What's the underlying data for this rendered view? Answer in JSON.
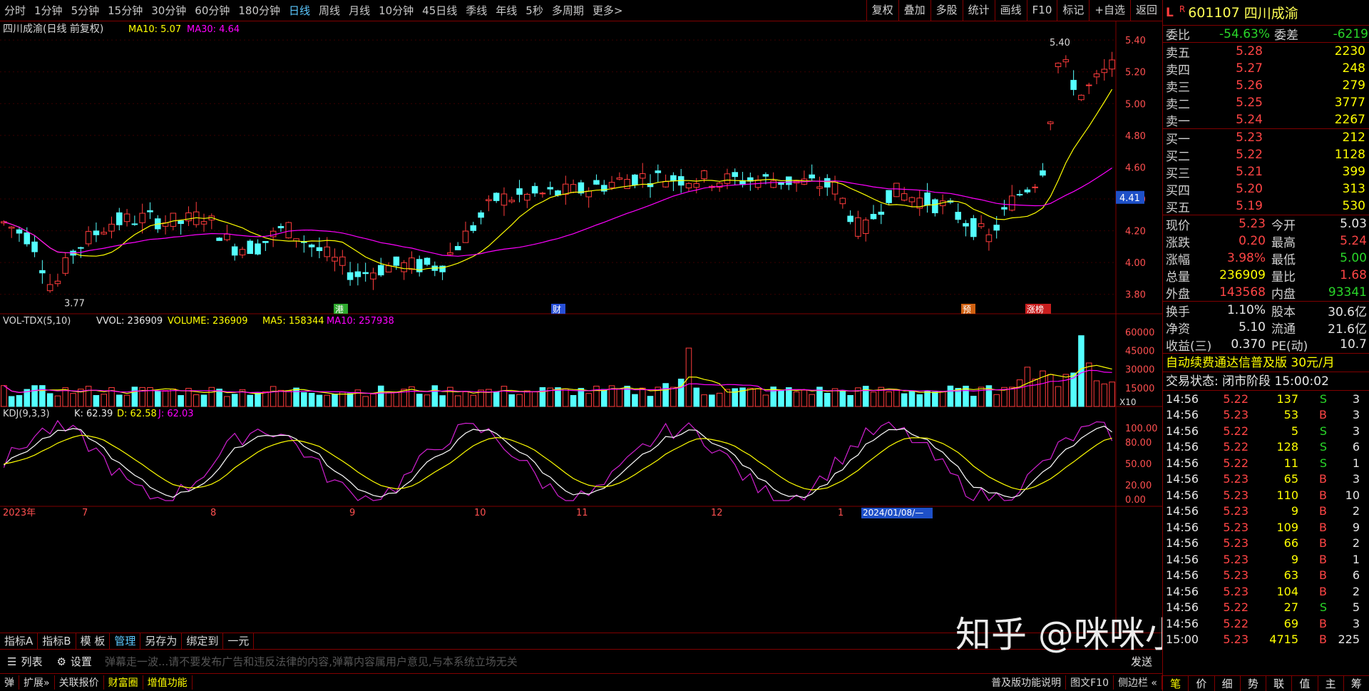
{
  "toolbar": {
    "periods": [
      "分时",
      "1分钟",
      "5分钟",
      "15分钟",
      "30分钟",
      "60分钟",
      "180分钟",
      "日线",
      "周线",
      "月线",
      "10分钟",
      "45日线",
      "季线",
      "年线",
      "5秒",
      "多周期",
      "更多>"
    ],
    "active_period": "日线",
    "tools": [
      "复权",
      "叠加",
      "多股",
      "统计",
      "画线",
      "F10",
      "标记",
      "+自选",
      "返回"
    ]
  },
  "main_header": {
    "title": "四川成渝(日线 前复权)",
    "ma10": "MA10: 5.07",
    "ma30": "MA30: 4.64"
  },
  "price_axis": [
    "5.40",
    "5.20",
    "5.00",
    "4.80",
    "4.60",
    "4.40",
    "4.20",
    "4.00",
    "3.80"
  ],
  "current_price_tag": "4.41",
  "annotations": {
    "high": "5.40",
    "low": "3.77"
  },
  "event_markers": [
    "港",
    "财",
    "预",
    "涨榜"
  ],
  "vol_header": {
    "name": "VOL-TDX(5,10)",
    "vvol": "VVOL: 236909",
    "volume": "VOLUME: 236909",
    "ma5": "MA5: 158344",
    "ma10": "MA10: 257938"
  },
  "vol_axis": [
    "60000",
    "45000",
    "30000",
    "15000"
  ],
  "vol_unit": "X10",
  "kdj_header": {
    "name": "KDJ(9,3,3)",
    "k": "K: 62.39",
    "d": "D: 62.58",
    "j": "J: 62.03"
  },
  "kdj_axis": [
    "100.00",
    "80.00",
    "50.00",
    "20.00",
    "0.00"
  ],
  "date_axis": [
    "2023年",
    "7",
    "8",
    "9",
    "10",
    "11",
    "12",
    "1"
  ],
  "date_cursor": "2024/01/08/—",
  "bottom_tabs": [
    "指标A",
    "指标B",
    "模 板",
    "管理",
    "另存为",
    "绑定到",
    "一元"
  ],
  "comment_bar": {
    "list": "列表",
    "settings": "设置",
    "placeholder": "弹幕走一波...请不要发布广告和违反法律的内容,弹幕内容属用户意见,与本系统立场无关",
    "send": "发送"
  },
  "status_bar": {
    "items": [
      "弹",
      "扩展»",
      "关联报价",
      "财富圈",
      "增值功能"
    ],
    "right": [
      "普及版功能说明",
      "图文F10",
      "侧边栏 «"
    ]
  },
  "watermark": "知乎 @咪咪小超人",
  "colors": {
    "up": "#ff3c3c",
    "down": "#54ffff",
    "ma_yellow": "#ffff00",
    "ma_magenta": "#ff00ff",
    "grid": "#800000"
  },
  "quote": {
    "flag": "L",
    "flag_r": "R",
    "code": "601107",
    "name": "四川成渝",
    "wb_label": "委比",
    "wb": "-54.63%",
    "wc_label": "委差",
    "wc": "-6219",
    "asks": [
      {
        "label": "卖五",
        "price": "5.28",
        "qty": "2230"
      },
      {
        "label": "卖四",
        "price": "5.27",
        "qty": "248"
      },
      {
        "label": "卖三",
        "price": "5.26",
        "qty": "279"
      },
      {
        "label": "卖二",
        "price": "5.25",
        "qty": "3777"
      },
      {
        "label": "卖一",
        "price": "5.24",
        "qty": "2267"
      }
    ],
    "bids": [
      {
        "label": "买一",
        "price": "5.23",
        "qty": "212"
      },
      {
        "label": "买二",
        "price": "5.22",
        "qty": "1128"
      },
      {
        "label": "买三",
        "price": "5.21",
        "qty": "399"
      },
      {
        "label": "买四",
        "price": "5.20",
        "qty": "313"
      },
      {
        "label": "买五",
        "price": "5.19",
        "qty": "530"
      }
    ],
    "stats": [
      {
        "l1": "现价",
        "v1": "5.23",
        "c1": "red",
        "l2": "今开",
        "v2": "5.03",
        "c2": "wht"
      },
      {
        "l1": "涨跌",
        "v1": "0.20",
        "c1": "red",
        "l2": "最高",
        "v2": "5.24",
        "c2": "red"
      },
      {
        "l1": "涨幅",
        "v1": "3.98%",
        "c1": "red",
        "l2": "最低",
        "v2": "5.00",
        "c2": "grn"
      },
      {
        "l1": "总量",
        "v1": "236909",
        "c1": "yel",
        "l2": "量比",
        "v2": "1.68",
        "c2": "red"
      },
      {
        "l1": "外盘",
        "v1": "143568",
        "c1": "red",
        "l2": "内盘",
        "v2": "93341",
        "c2": "grn"
      }
    ],
    "fund": [
      {
        "l1": "换手",
        "v1": "1.10%",
        "l2": "股本",
        "v2": "30.6亿"
      },
      {
        "l1": "净资",
        "v1": "5.10",
        "l2": "流通",
        "v2": "21.6亿"
      },
      {
        "l1": "收益(三)",
        "v1": "0.370",
        "l2": "PE(动)",
        "v2": "10.7"
      }
    ],
    "ad": "自动续费通达信普及版  30元/月",
    "trade_state": "交易状态: 闭市阶段 15:00:02",
    "trades": [
      [
        "14:56",
        "5.22",
        "137",
        "S",
        "3"
      ],
      [
        "14:56",
        "5.23",
        "53",
        "B",
        "3"
      ],
      [
        "14:56",
        "5.22",
        "5",
        "S",
        "3"
      ],
      [
        "14:56",
        "5.22",
        "128",
        "S",
        "6"
      ],
      [
        "14:56",
        "5.22",
        "11",
        "S",
        "1"
      ],
      [
        "14:56",
        "5.23",
        "65",
        "B",
        "3"
      ],
      [
        "14:56",
        "5.23",
        "110",
        "B",
        "10"
      ],
      [
        "14:56",
        "5.23",
        "9",
        "B",
        "2"
      ],
      [
        "14:56",
        "5.23",
        "109",
        "B",
        "9"
      ],
      [
        "14:56",
        "5.23",
        "66",
        "B",
        "2"
      ],
      [
        "14:56",
        "5.23",
        "9",
        "B",
        "1"
      ],
      [
        "14:56",
        "5.23",
        "63",
        "B",
        "6"
      ],
      [
        "14:56",
        "5.23",
        "104",
        "B",
        "2"
      ],
      [
        "14:56",
        "5.22",
        "27",
        "S",
        "5"
      ],
      [
        "14:56",
        "5.22",
        "69",
        "B",
        "3"
      ],
      [
        "15:00",
        "5.23",
        "4715",
        "B",
        "225"
      ]
    ],
    "bottom_tabs": [
      "笔",
      "价",
      "细",
      "势",
      "联",
      "值",
      "主",
      "筹"
    ]
  }
}
